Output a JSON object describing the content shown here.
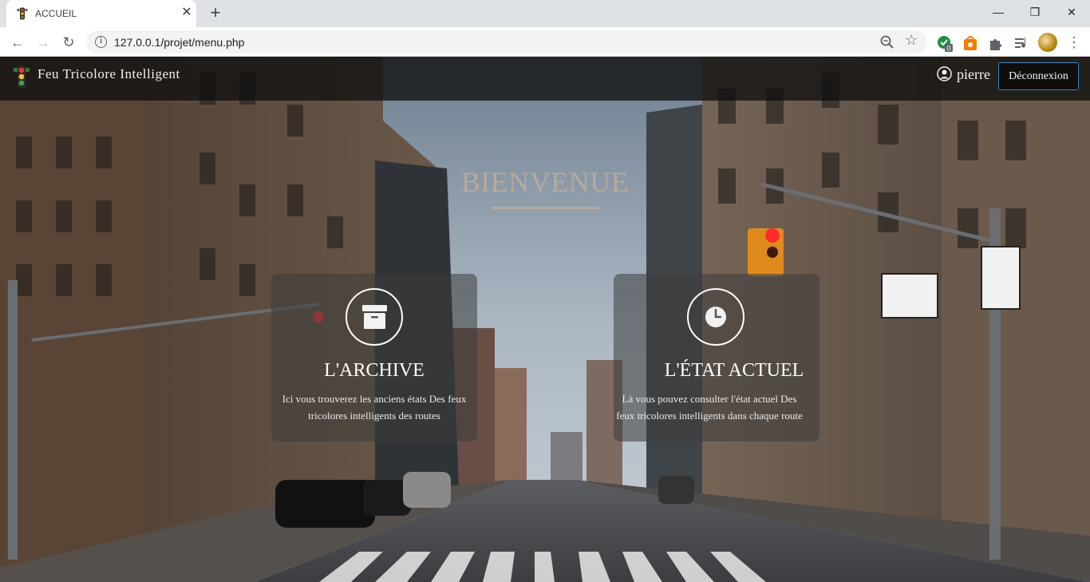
{
  "browser": {
    "tab_title": "ACCUEIL",
    "new_tab_symbol": "+",
    "close_tab_symbol": "✕",
    "url": "127.0.0.1/projet/menu.php",
    "extension_badge": "0",
    "window_controls": {
      "minimize": "—",
      "maximize": "❐",
      "close": "✕"
    }
  },
  "navbar": {
    "brand": "Feu Tricolore Intelligent",
    "username": "pierre",
    "logout_label": "Déconnexion"
  },
  "hero": {
    "title": "BIENVENUE"
  },
  "cards": [
    {
      "title": "L'ARCHIVE",
      "description": "Ici vous trouverez les anciens états Des feux tricolores intelligents des routes",
      "icon": "archive-icon"
    },
    {
      "title": "L'ÉTAT ACTUEL",
      "description": "Là vous pouvez consulter l'état actuel Des feux tricolores intelligents dans chaque route",
      "icon": "clock-icon"
    }
  ],
  "colors": {
    "welcome_text": "#b8aa9c",
    "logout_border": "#3b82c4",
    "navbar_bg": "rgba(15,15,15,0.78)",
    "card_bg": "rgba(60,60,60,0.55)"
  }
}
